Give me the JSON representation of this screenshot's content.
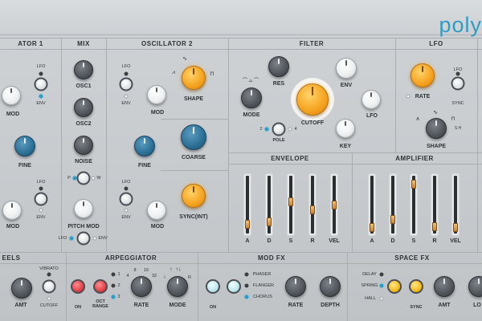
{
  "brand": {
    "name": "poly"
  },
  "sections": {
    "osc1": "ATOR 1",
    "mix": "MIX",
    "osc2": "OSCILLATOR 2",
    "filter": "FILTER",
    "lfo": "LFO",
    "envelope": "ENVELOPE",
    "amplifier": "AMPLIFIER",
    "wheels": "EELS",
    "arp": "ARPEGGIATOR",
    "modfx": "MOD FX",
    "spacefx": "SPACE FX"
  },
  "osc1": {
    "mod": "MOD",
    "fine": "FINE",
    "lfo": "LFO",
    "env": "ENV",
    "lfo2": "LFO",
    "env2": "ENV",
    "mod2": "MOD"
  },
  "mix": {
    "osc1": "OSC1",
    "osc2": "OSC2",
    "noise": "NOISE",
    "p": "P",
    "w": "W",
    "pitch_mod": "PITCH MOD",
    "lfo": "LFO",
    "env": "ENV"
  },
  "osc2": {
    "lfo": "LFO",
    "env": "ENV",
    "mod": "MOD",
    "shape": "SHAPE",
    "fine": "FINE",
    "coarse": "COARSE",
    "lfo2": "LFO",
    "env2": "ENV",
    "mod2": "MOD",
    "sync": "SYNC(INT)"
  },
  "filter": {
    "res": "RES",
    "env": "ENV",
    "mode": "MODE",
    "cutoff": "CUTOFF",
    "lfo": "LFO",
    "pole_2": "2",
    "pole_4": "4",
    "pole": "POLE",
    "key": "KEY"
  },
  "lfo": {
    "rate": "RATE",
    "lfo_label": "LFO",
    "sync": "SYNC",
    "shape": "SHAPE"
  },
  "envelope": {
    "sliders": [
      {
        "label": "A",
        "value": 0.1
      },
      {
        "label": "D",
        "value": 0.15
      },
      {
        "label": "S",
        "value": 0.55
      },
      {
        "label": "R",
        "value": 0.4
      },
      {
        "label": "VEL",
        "value": 0.5
      }
    ]
  },
  "amplifier": {
    "sliders": [
      {
        "label": "A",
        "value": 0.03
      },
      {
        "label": "D",
        "value": 0.2
      },
      {
        "label": "S",
        "value": 0.92
      },
      {
        "label": "R",
        "value": 0.05
      },
      {
        "label": "VEL",
        "value": 0.03
      }
    ]
  },
  "wheels": {
    "amt": "AMT",
    "vibrato": "VIBRATO",
    "cutoff": "CUTOFF"
  },
  "arp": {
    "on": "ON",
    "oct_range": "OCT RANGE",
    "oct_1": "1",
    "oct_2": "2",
    "oct_3": "3",
    "rate": "RATE",
    "rate_8": "8",
    "rate_16": "16",
    "rate_32": "32",
    "rate_4": "4",
    "mode": "MODE",
    "mode_r": "R"
  },
  "modfx": {
    "on": "ON",
    "phaser": "PHASER",
    "flanger": "FLANGER",
    "chorus": "CHORUS",
    "rate": "RATE",
    "depth": "DEPTH"
  },
  "spacefx": {
    "delay": "DELAY",
    "spring": "SPRING",
    "hall": "HALL",
    "sync": "SYNC",
    "amt": "AMT",
    "lo": "LO"
  },
  "colors": {
    "accent_blue": "#2e9cc4",
    "knob_orange": "#f6a623",
    "knob_blue": "#2c6f95",
    "button_red": "#e3434b",
    "button_yellow": "#f4bd1f",
    "button_cyan": "#bfe8ee"
  }
}
